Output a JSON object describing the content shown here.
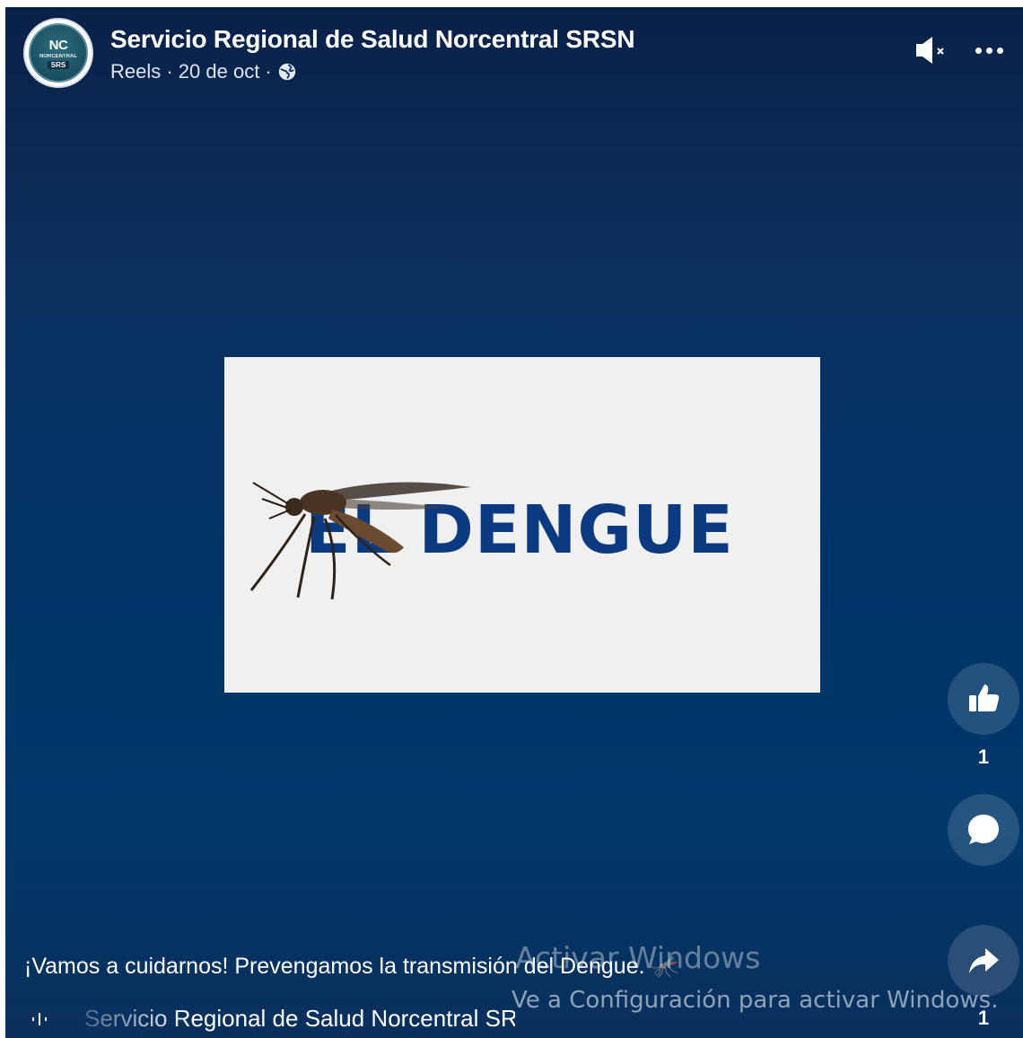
{
  "header": {
    "page_name": "Servicio Regional de Salud Norcentral SRSN",
    "meta_text": "Reels · 20 de oct ·",
    "privacy_icon": "globe-icon",
    "avatar": {
      "main": "NC",
      "sub": "NORCENTRAL",
      "badge": "SRS"
    },
    "mute_icon": "speaker-muted-icon",
    "more_icon": "more-horizontal-icon"
  },
  "video": {
    "title_text": "EL DENGUE",
    "background_color": "#f0f0f0",
    "text_color": "#0b3a80"
  },
  "actions": {
    "like_count": "1",
    "share_count": "1",
    "like_icon": "thumbs-up-icon",
    "comment_icon": "comment-bubble-icon",
    "share_icon": "share-arrow-icon"
  },
  "caption": {
    "text": "¡Vamos a cuidarnos! Prevengamos la transmisión del Dengue. 🦟"
  },
  "audio": {
    "icon": "audio-wave-icon",
    "text": "Servicio Regional de Salud Norcentral SRSN · Audio original"
  },
  "watermark": {
    "title": "Activar Windows",
    "subtitle": "Ve a Configuración para activar Windows."
  },
  "colors": {
    "accent": "#0b3a80",
    "background_top": "#0a2147",
    "background_bottom": "#003467"
  }
}
